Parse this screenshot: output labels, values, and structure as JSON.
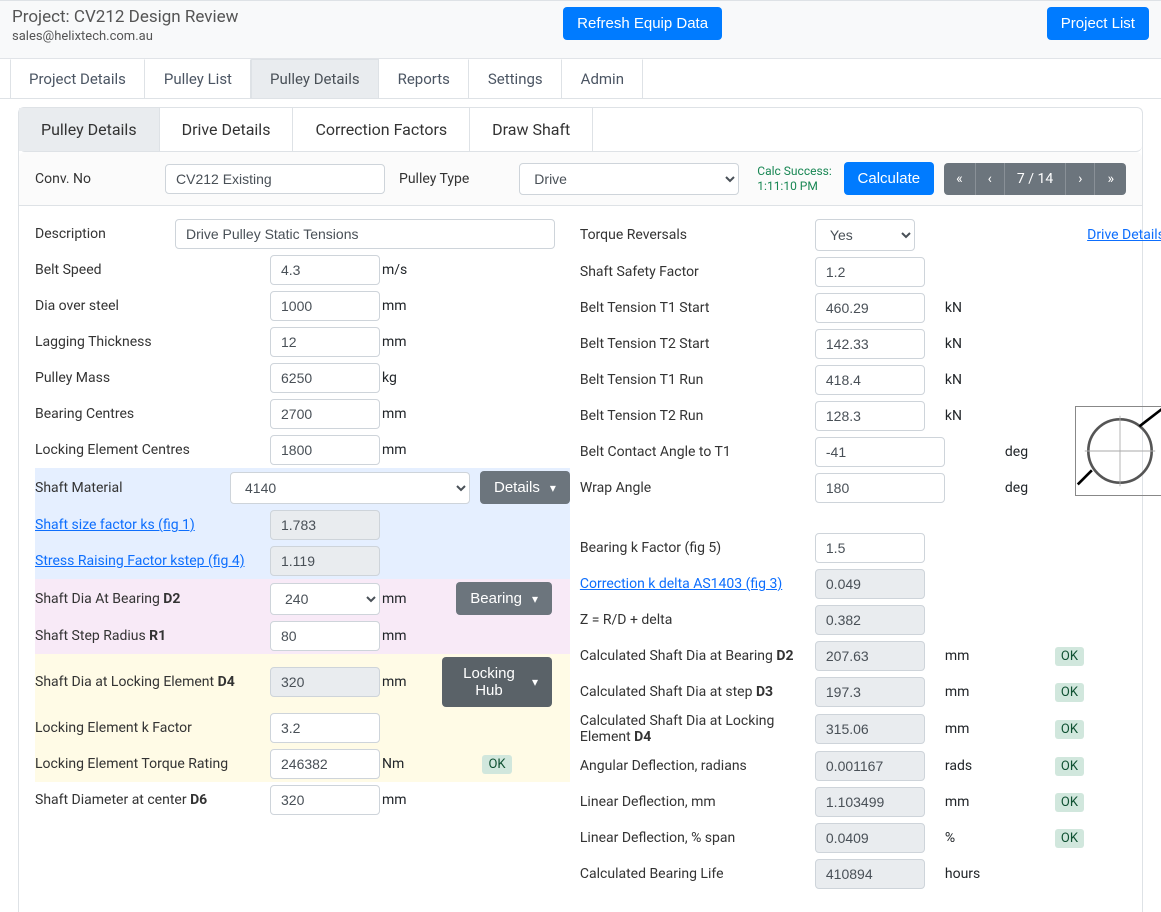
{
  "header": {
    "title": "Project: CV212 Design Review",
    "email": "sales@helixtech.com.au",
    "refresh_btn": "Refresh Equip Data",
    "projectlist_btn": "Project List"
  },
  "tabs": {
    "projectDetails": "Project Details",
    "pulleyList": "Pulley List",
    "pulleyDetails": "Pulley Details",
    "reports": "Reports",
    "settings": "Settings",
    "admin": "Admin"
  },
  "subtabs": {
    "pulleyDetails": "Pulley Details",
    "driveDetails": "Drive Details",
    "correction": "Correction Factors",
    "drawShaft": "Draw Shaft"
  },
  "topline": {
    "convNoLbl": "Conv. No",
    "convNo": "CV212 Existing",
    "pulleyTypeLbl": "Pulley Type",
    "pulleyType": "Drive",
    "calcSuccess": "Calc Success:",
    "calcTime": "1:11:10 PM",
    "calculate": "Calculate",
    "pagePos": "7 / 14"
  },
  "left": {
    "descriptionLbl": "Description",
    "description": "Drive Pulley Static Tensions",
    "beltSpeedLbl": "Belt Speed",
    "beltSpeed": "4.3",
    "beltSpeedU": "m/s",
    "diaSteelLbl": "Dia over steel",
    "diaSteel": "1000",
    "mm": "mm",
    "lagThkLbl": "Lagging Thickness",
    "lagThk": "12",
    "pulleyMassLbl": "Pulley Mass",
    "pulleyMass": "6250",
    "kg": "kg",
    "brgCentresLbl": "Bearing Centres",
    "brgCentres": "2700",
    "lockCentresLbl": "Locking Element Centres",
    "lockCentres": "1800",
    "shaftMatLbl": "Shaft Material",
    "shaftMat": "4140",
    "details": "Details",
    "ksLbl": "Shaft size factor ks (fig 1)",
    "ks": "1.783",
    "kstepLbl": "Stress Raising Factor kstep (fig 4)",
    "kstep": "1.119",
    "d2Lbl": "Shaft Dia At Bearing ",
    "d2b": "D2",
    "d2": "240",
    "bearing": "Bearing",
    "r1Lbl": "Shaft Step Radius ",
    "r1b": "R1",
    "r1": "80",
    "d4Lbl": "Shaft Dia at Locking Element ",
    "d4b": "D4",
    "d4": "320",
    "lockingHub": "Locking Hub",
    "lockKLbl": "Locking Element k Factor",
    "lockK": "3.2",
    "lockTrqLbl": "Locking Element Torque Rating",
    "lockTrq": "246382",
    "nm": "Nm",
    "ok": "OK",
    "d6Lbl": "Shaft Diameter at center ",
    "d6b": "D6",
    "d6": "320"
  },
  "right": {
    "torqueRevLbl": "Torque Reversals",
    "torqueRev": "Yes",
    "driveDetails": "Drive Details",
    "ssfLbl": "Shaft Safety Factor",
    "ssf": "1.2",
    "t1sLbl": "Belt Tension T1 Start",
    "t1s": "460.29",
    "kn": "kN",
    "t2sLbl": "Belt Tension T2 Start",
    "t2s": "142.33",
    "t1rLbl": "Belt Tension T1 Run",
    "t1r": "418.4",
    "t2rLbl": "Belt Tension T2 Run",
    "t2r": "128.3",
    "bcaLbl": "Belt Contact Angle to T1",
    "bca": "-41",
    "deg": "deg",
    "wrapLbl": "Wrap Angle",
    "wrap": "180",
    "bkfLbl": "Bearing k Factor (fig 5)",
    "bkf": "1.5",
    "ckdLbl": "Correction k delta AS1403 (fig 3)",
    "ckd": "0.049",
    "zLbl": "Z = R/D + delta",
    "z": "0.382",
    "cd2Lbl": "Calculated Shaft Dia at Bearing ",
    "cd2b": "D2",
    "cd2": "207.63",
    "cd3Lbl": "Calculated Shaft Dia at step ",
    "cd3b": "D3",
    "cd3": "197.3",
    "cd4Lbl": "Calculated Shaft Dia at Locking Element ",
    "cd4b": "D4",
    "cd4": "315.06",
    "angDefLbl": "Angular Deflection, radians",
    "angDef": "0.001167",
    "rads": "rads",
    "linDefLbl": "Linear Deflection, mm",
    "linDef": "1.103499",
    "linPctLbl": "Linear Deflection, % span",
    "linPct": "0.0409",
    "pct": "%",
    "brgLifeLbl": "Calculated Bearing Life",
    "brgLife": "410894",
    "hours": "hours"
  }
}
